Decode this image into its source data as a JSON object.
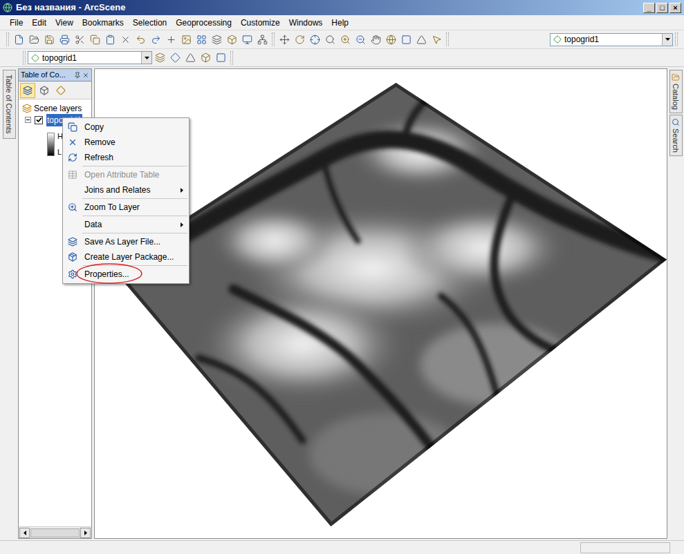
{
  "window": {
    "title": "Без названия - ArcScene",
    "controls": [
      "_",
      "□",
      "×"
    ]
  },
  "menu": [
    "File",
    "Edit",
    "View",
    "Bookmarks",
    "Selection",
    "Geoprocessing",
    "Customize",
    "Windows",
    "Help"
  ],
  "toolbar": {
    "layer_dropdown": "topogrid1"
  },
  "toolbar2": {
    "layer_dropdown": "topogrid1"
  },
  "toc": {
    "tab_label": "Table of Contents",
    "title": "Table of Co...",
    "root": "Scene layers",
    "root_expanded": true,
    "layers": [
      {
        "name": "topogrid1",
        "checked": true,
        "selected": true,
        "expanded": true,
        "legend": [
          "H",
          "L"
        ]
      }
    ]
  },
  "context_menu": {
    "items": [
      {
        "kind": "item",
        "label": "Copy",
        "disabled": false,
        "submenu": false,
        "circled": false
      },
      {
        "kind": "item",
        "label": "Remove",
        "disabled": false,
        "submenu": false,
        "circled": false
      },
      {
        "kind": "item",
        "label": "Refresh",
        "disabled": false,
        "submenu": false,
        "circled": false
      },
      {
        "kind": "separator"
      },
      {
        "kind": "item",
        "label": "Open Attribute Table",
        "disabled": true,
        "submenu": false,
        "circled": false
      },
      {
        "kind": "item",
        "label": "Joins and Relates",
        "disabled": false,
        "submenu": true,
        "circled": false
      },
      {
        "kind": "separator"
      },
      {
        "kind": "item",
        "label": "Zoom To Layer",
        "disabled": false,
        "submenu": false,
        "circled": false
      },
      {
        "kind": "separator"
      },
      {
        "kind": "item",
        "label": "Data",
        "disabled": false,
        "submenu": true,
        "circled": false
      },
      {
        "kind": "separator"
      },
      {
        "kind": "item",
        "label": "Save As Layer File...",
        "disabled": false,
        "submenu": false,
        "circled": false
      },
      {
        "kind": "item",
        "label": "Create Layer Package...",
        "disabled": false,
        "submenu": false,
        "circled": false
      },
      {
        "kind": "separator"
      },
      {
        "kind": "item",
        "label": "Properties...",
        "disabled": false,
        "submenu": false,
        "circled": true
      }
    ]
  },
  "side_tabs": [
    "Catalog",
    "Search"
  ]
}
